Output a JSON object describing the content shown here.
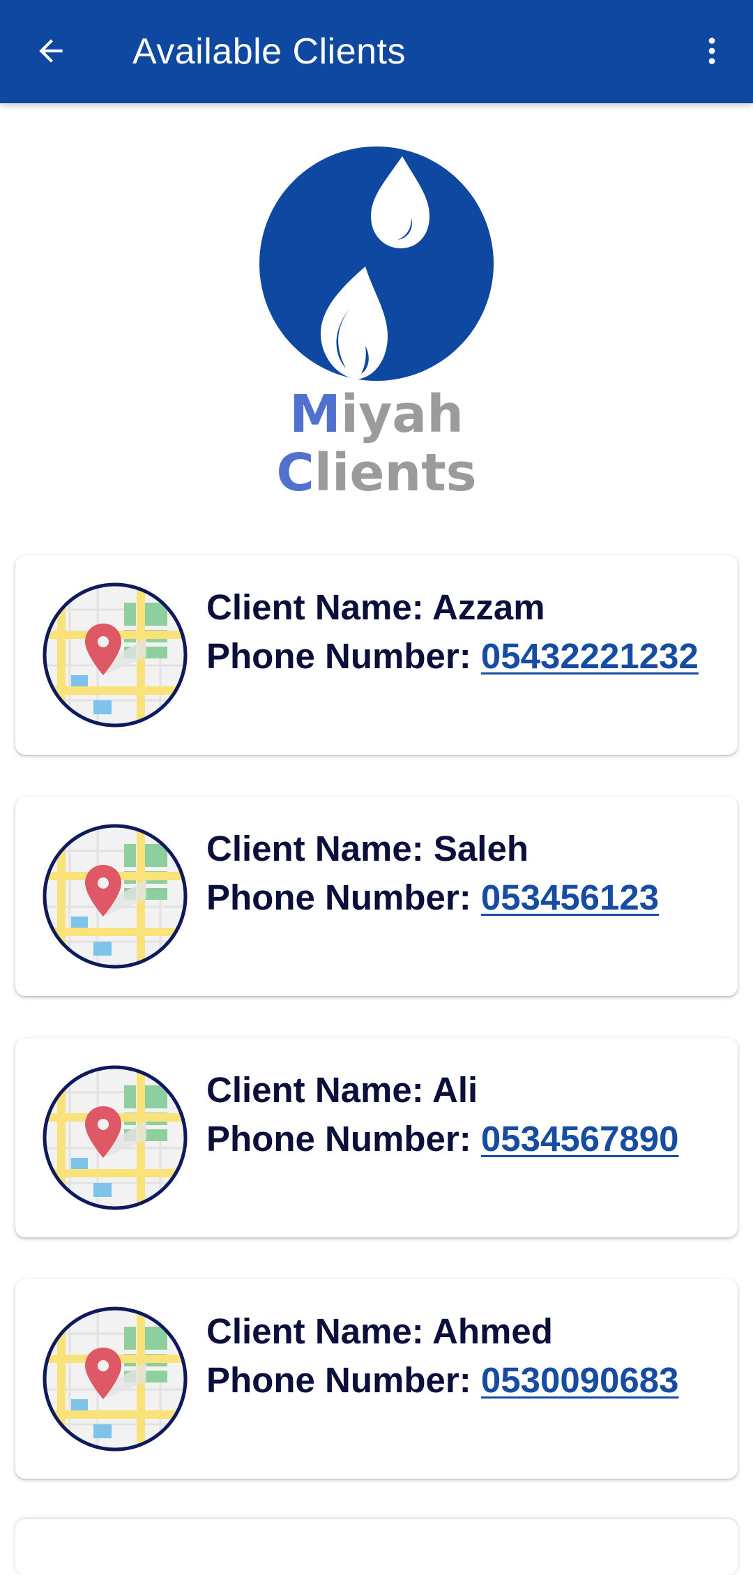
{
  "app_bar": {
    "title": "Available Clients",
    "back_icon": "arrow-left-icon",
    "menu_icon": "more-vert-icon",
    "background": "#0f48a1"
  },
  "logo": {
    "icon": "water-drops-logo",
    "line1_initial": "M",
    "line1_rest": "iyah",
    "line2_initial": "C",
    "line2_rest": "lients",
    "accent_color": "#5270d0",
    "text_color": "#9b9b9b"
  },
  "labels": {
    "client_name": "Client Name:",
    "phone_number": "Phone Number:"
  },
  "clients": [
    {
      "name": "Azzam",
      "phone": "05432221232",
      "icon": "map-pin-icon"
    },
    {
      "name": "Saleh",
      "phone": "053456123",
      "icon": "map-pin-icon"
    },
    {
      "name": "Ali",
      "phone": "0534567890",
      "icon": "map-pin-icon"
    },
    {
      "name": "Ahmed",
      "phone": "0530090683",
      "icon": "map-pin-icon"
    }
  ]
}
